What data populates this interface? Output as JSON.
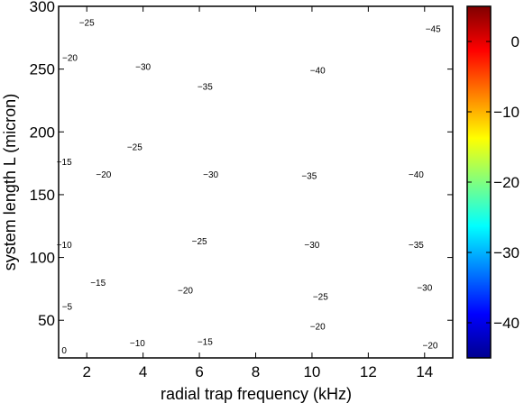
{
  "chart_data": {
    "type": "contour",
    "xlabel": "radial trap frequency (kHz)",
    "ylabel": "system length L (micron)",
    "xlim": [
      1,
      15
    ],
    "ylim": [
      20,
      300
    ],
    "xticks": [
      2,
      4,
      6,
      8,
      10,
      12,
      14
    ],
    "yticks": [
      50,
      100,
      150,
      200,
      250,
      300
    ],
    "colorbar": {
      "colormap": "jet",
      "range": [
        -45,
        5
      ],
      "ticks": [
        0,
        -10,
        -20,
        -30,
        -40
      ],
      "tick_labels": [
        "0",
        "−10",
        "−20",
        "−30",
        "−40"
      ]
    },
    "contour_levels": [
      0,
      -5,
      -10,
      -15,
      -20,
      -25,
      -30,
      -35,
      -40,
      -45
    ],
    "contour_labels": [
      {
        "level": -45,
        "text": "−45",
        "x": 14.3,
        "y": 282
      },
      {
        "level": -40,
        "text": "−40",
        "x": 10.2,
        "y": 249
      },
      {
        "level": -40,
        "text": "−40",
        "x": 13.7,
        "y": 166
      },
      {
        "level": -35,
        "text": "−35",
        "x": 6.2,
        "y": 236
      },
      {
        "level": -35,
        "text": "−35",
        "x": 9.9,
        "y": 165
      },
      {
        "level": -35,
        "text": "−35",
        "x": 13.7,
        "y": 110
      },
      {
        "level": -30,
        "text": "−30",
        "x": 4.0,
        "y": 252
      },
      {
        "level": -30,
        "text": "−30",
        "x": 6.4,
        "y": 166
      },
      {
        "level": -30,
        "text": "−30",
        "x": 10.0,
        "y": 110
      },
      {
        "level": -30,
        "text": "−30",
        "x": 14.0,
        "y": 76
      },
      {
        "level": -25,
        "text": "−25",
        "x": 2.0,
        "y": 287
      },
      {
        "level": -25,
        "text": "−25",
        "x": 3.7,
        "y": 188
      },
      {
        "level": -25,
        "text": "−25",
        "x": 6.0,
        "y": 113
      },
      {
        "level": -25,
        "text": "−25",
        "x": 10.3,
        "y": 69
      },
      {
        "level": -20,
        "text": "−20",
        "x": 1.4,
        "y": 259
      },
      {
        "level": -20,
        "text": "−20",
        "x": 2.6,
        "y": 166
      },
      {
        "level": -20,
        "text": "−20",
        "x": 5.5,
        "y": 74
      },
      {
        "level": -20,
        "text": "−20",
        "x": 10.2,
        "y": 45
      },
      {
        "level": -20,
        "text": "−20",
        "x": 14.2,
        "y": 30
      },
      {
        "level": -15,
        "text": "−15",
        "x": 1.2,
        "y": 176
      },
      {
        "level": -15,
        "text": "−15",
        "x": 2.4,
        "y": 80
      },
      {
        "level": -15,
        "text": "−15",
        "x": 6.2,
        "y": 33
      },
      {
        "level": -10,
        "text": "−10",
        "x": 1.2,
        "y": 110
      },
      {
        "level": -10,
        "text": "−10",
        "x": 3.8,
        "y": 32
      },
      {
        "level": -5,
        "text": "−5",
        "x": 1.3,
        "y": 61
      },
      {
        "level": 0,
        "text": "0",
        "x": 1.2,
        "y": 26
      }
    ]
  }
}
